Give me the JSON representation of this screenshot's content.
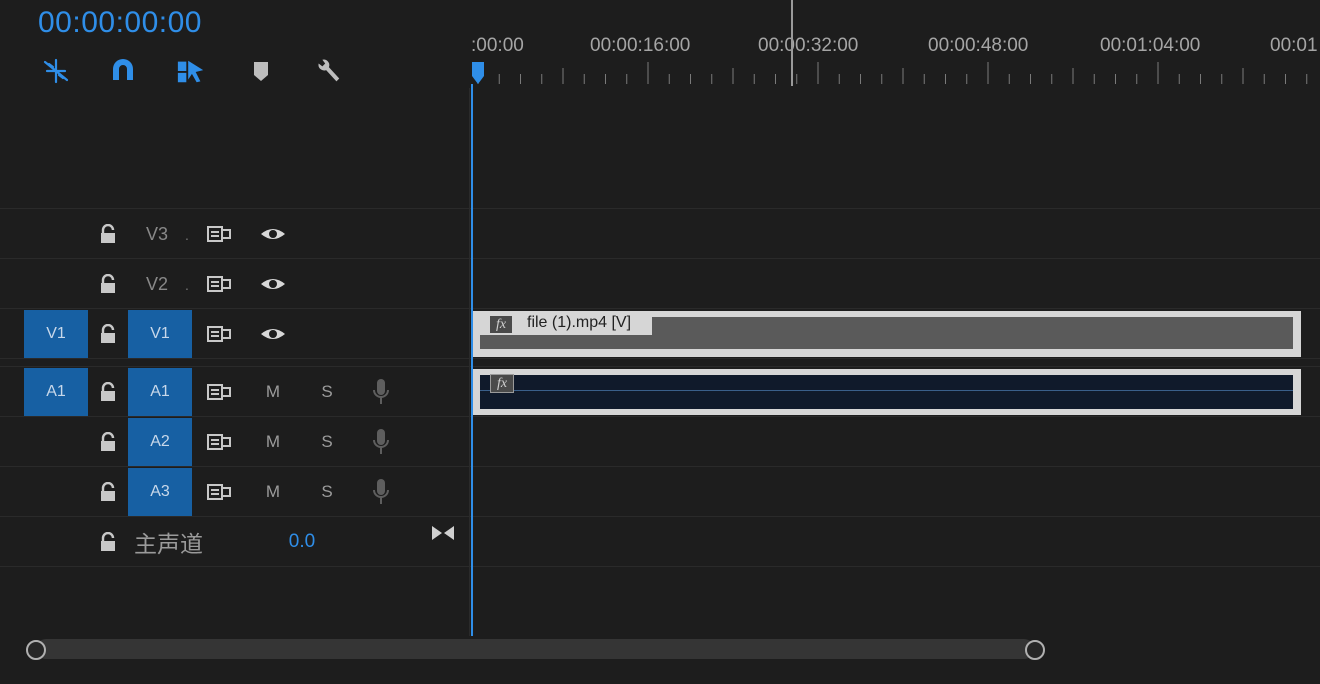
{
  "timecode": "00:00:00:00",
  "toolbar": {
    "icons": [
      "snap-link-icon",
      "magnet-icon",
      "linked-selection-icon",
      "marker-icon",
      "wrench-icon"
    ]
  },
  "ruler": {
    "labels": [
      ":00:00",
      "00:00:16:00",
      "00:00:32:00",
      "00:00:48:00",
      "00:01:04:00",
      "00:01"
    ]
  },
  "tracks": {
    "video": [
      {
        "label": "V3",
        "source": ""
      },
      {
        "label": "V2",
        "source": ""
      },
      {
        "label": "V1",
        "source": "V1"
      }
    ],
    "audio": [
      {
        "label": "A1",
        "source": "A1",
        "mute": "M",
        "solo": "S"
      },
      {
        "label": "A2",
        "source": "",
        "mute": "M",
        "solo": "S"
      },
      {
        "label": "A3",
        "source": "",
        "mute": "M",
        "solo": "S"
      }
    ],
    "master": {
      "label": "主声道",
      "value": "0.0"
    }
  },
  "clips": {
    "video_clip": {
      "fx": "fx",
      "name": "file (1).mp4 [V]"
    },
    "audio_clip": {
      "fx": "fx"
    }
  },
  "colors": {
    "accent": "#2f8ee8",
    "target": "#1760a3",
    "clip_video": "#5a5a5a",
    "clip_audio": "#101a2b"
  }
}
